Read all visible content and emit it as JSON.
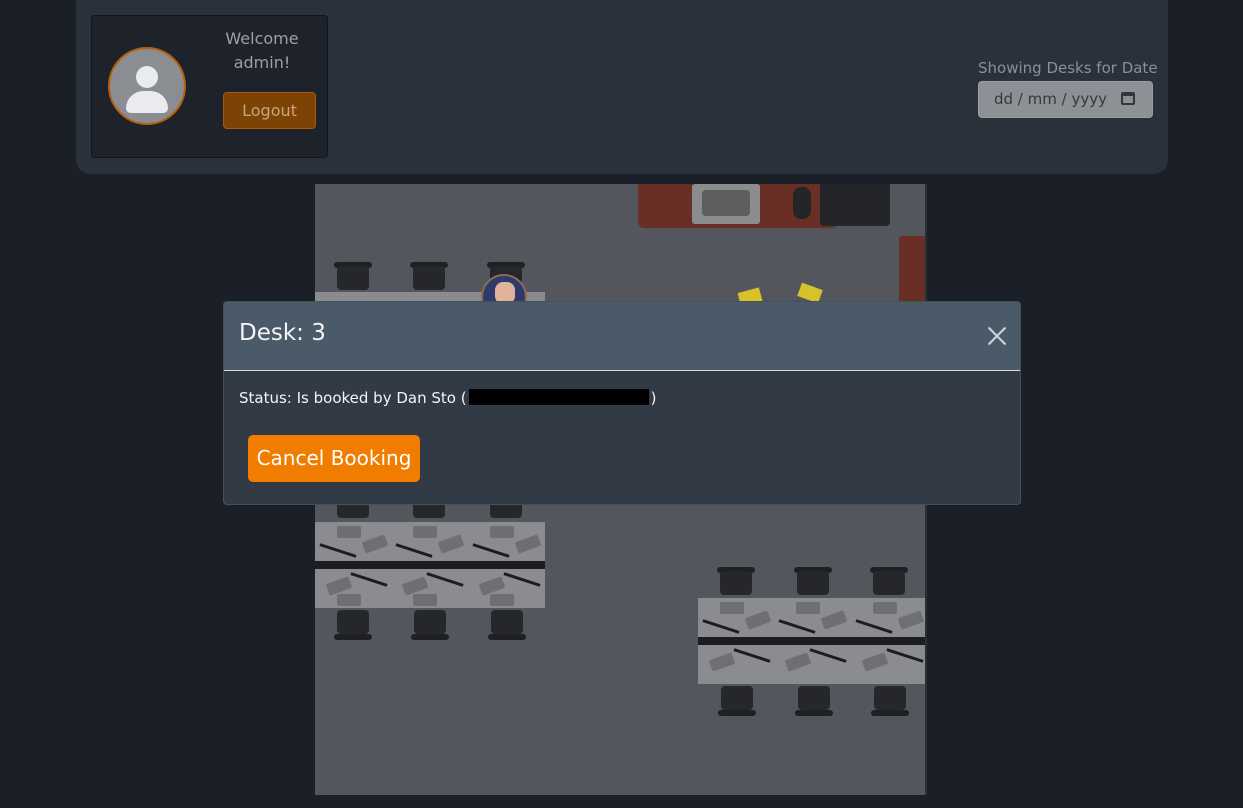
{
  "header": {
    "welcome_line1": "Welcome",
    "welcome_line2": "admin!",
    "logout_label": "Logout",
    "date_label": "Showing Desks for Date",
    "date_placeholder": "dd / mm / yyyy",
    "avatar_icon": "user-silhouette-icon",
    "calendar_icon": "calendar-icon"
  },
  "modal": {
    "title": "Desk: 3",
    "status_prefix": "Status: Is booked by Dan Sto (",
    "status_suffix": ")",
    "cancel_label": "Cancel Booking",
    "close_icon": "close-icon"
  },
  "colors": {
    "accent": "#f07d00",
    "background": "#1b1f27",
    "modal_header": "#4a5a69"
  }
}
